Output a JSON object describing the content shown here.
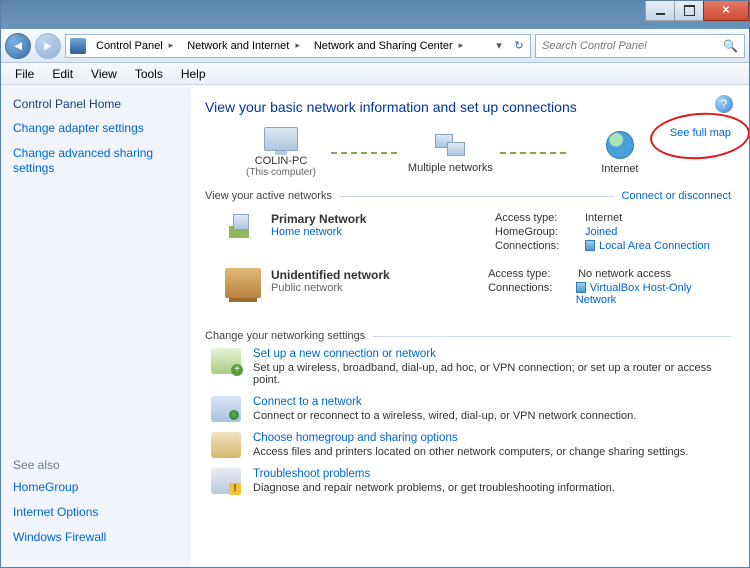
{
  "title_buttons": {
    "min": "Minimize",
    "max": "Maximize",
    "close": "Close"
  },
  "nav": {
    "back": "Back",
    "forward": "Forward",
    "crumbs": [
      "Control Panel",
      "Network and Internet",
      "Network and Sharing Center"
    ],
    "refresh": "Refresh"
  },
  "search": {
    "placeholder": "Search Control Panel"
  },
  "menubar": [
    "File",
    "Edit",
    "View",
    "Tools",
    "Help"
  ],
  "sidebar": {
    "home": "Control Panel Home",
    "links": [
      "Change adapter settings",
      "Change advanced sharing settings"
    ],
    "see_also_label": "See also",
    "see_also": [
      "HomeGroup",
      "Internet Options",
      "Windows Firewall"
    ]
  },
  "main": {
    "heading": "View your basic network information and set up connections",
    "help_tooltip": "Get help",
    "map": {
      "node1": {
        "label": "COLIN-PC",
        "sub": "(This computer)"
      },
      "node2": {
        "label": "Multiple networks"
      },
      "node3": {
        "label": "Internet"
      },
      "see_full": "See full map"
    },
    "active_hdr": "View your active networks",
    "connect_link": "Connect or disconnect",
    "networks": [
      {
        "name": "Primary Network",
        "type_label": "Home network",
        "type_link": true,
        "props": {
          "access_k": "Access type:",
          "access_v": "Internet",
          "hg_k": "HomeGroup:",
          "hg_v": "Joined",
          "hg_link": true,
          "conn_k": "Connections:",
          "conn_v": "Local Area Connection",
          "conn_link": true
        },
        "icon": "ico-home"
      },
      {
        "name": "Unidentified network",
        "type_label": "Public network",
        "type_link": false,
        "props": {
          "access_k": "Access type:",
          "access_v": "No network access",
          "conn_k": "Connections:",
          "conn_v": "VirtualBox Host-Only Network",
          "conn_link": true
        },
        "icon": "ico-bench"
      }
    ],
    "change_hdr": "Change your networking settings",
    "tasks": [
      {
        "icon": "ico-setup",
        "title": "Set up a new connection or network",
        "desc": "Set up a wireless, broadband, dial-up, ad hoc, or VPN connection; or set up a router or access point."
      },
      {
        "icon": "ico-connect",
        "title": "Connect to a network",
        "desc": "Connect or reconnect to a wireless, wired, dial-up, or VPN network connection."
      },
      {
        "icon": "ico-hg",
        "title": "Choose homegroup and sharing options",
        "desc": "Access files and printers located on other network computers, or change sharing settings."
      },
      {
        "icon": "ico-trouble",
        "title": "Troubleshoot problems",
        "desc": "Diagnose and repair network problems, or get troubleshooting information."
      }
    ]
  }
}
